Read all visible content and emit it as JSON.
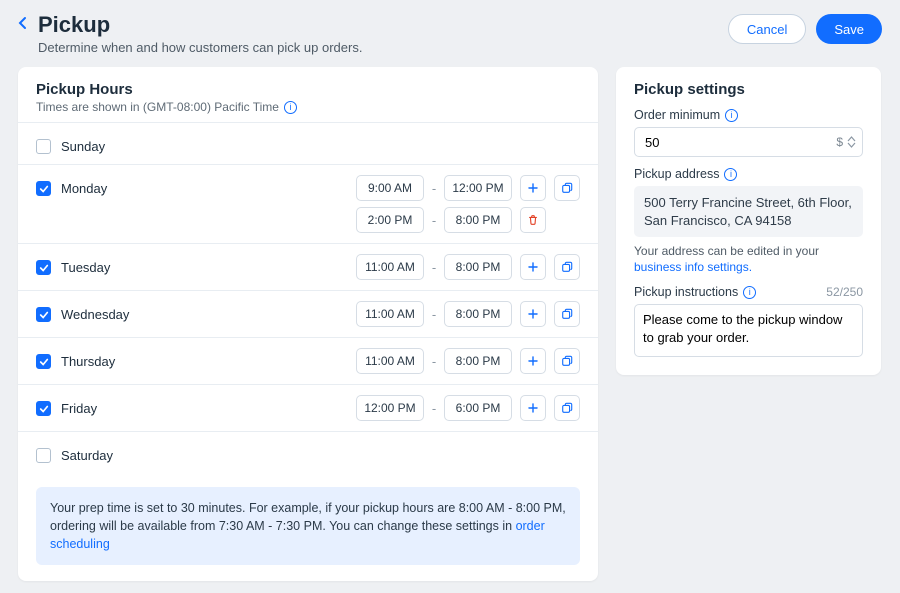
{
  "header": {
    "title": "Pickup",
    "subtitle": "Determine when and how customers can pick up orders.",
    "cancel_label": "Cancel",
    "save_label": "Save"
  },
  "hours": {
    "title": "Pickup Hours",
    "tz_note": "Times are shown in (GMT-08:00) Pacific Time",
    "days": [
      {
        "name": "Sunday",
        "enabled": false,
        "slots": []
      },
      {
        "name": "Monday",
        "enabled": true,
        "slots": [
          {
            "start": "9:00 AM",
            "end": "12:00 PM"
          },
          {
            "start": "2:00 PM",
            "end": "8:00 PM"
          }
        ]
      },
      {
        "name": "Tuesday",
        "enabled": true,
        "slots": [
          {
            "start": "11:00 AM",
            "end": "8:00 PM"
          }
        ]
      },
      {
        "name": "Wednesday",
        "enabled": true,
        "slots": [
          {
            "start": "11:00 AM",
            "end": "8:00 PM"
          }
        ]
      },
      {
        "name": "Thursday",
        "enabled": true,
        "slots": [
          {
            "start": "11:00 AM",
            "end": "8:00 PM"
          }
        ]
      },
      {
        "name": "Friday",
        "enabled": true,
        "slots": [
          {
            "start": "12:00 PM",
            "end": "6:00 PM"
          }
        ]
      },
      {
        "name": "Saturday",
        "enabled": false,
        "slots": []
      }
    ],
    "notice_prefix": "Your prep time is set to 30 minutes. For example, if your pickup hours are 8:00 AM - 8:00 PM, ordering will be available from 7:30 AM - 7:30 PM. You can change these settings in ",
    "notice_link": "order scheduling"
  },
  "settings": {
    "title": "Pickup settings",
    "min_label": "Order minimum",
    "min_value": "50",
    "min_unit": "$",
    "addr_label": "Pickup address",
    "addr_value": "500 Terry Francine Street, 6th Floor, San Francisco, CA 94158",
    "addr_hint_prefix": "Your address can be edited in your ",
    "addr_hint_link": "business info settings.",
    "instr_label": "Pickup instructions",
    "instr_count": "52/250",
    "instr_value": "Please come to the pickup window to grab your order."
  }
}
